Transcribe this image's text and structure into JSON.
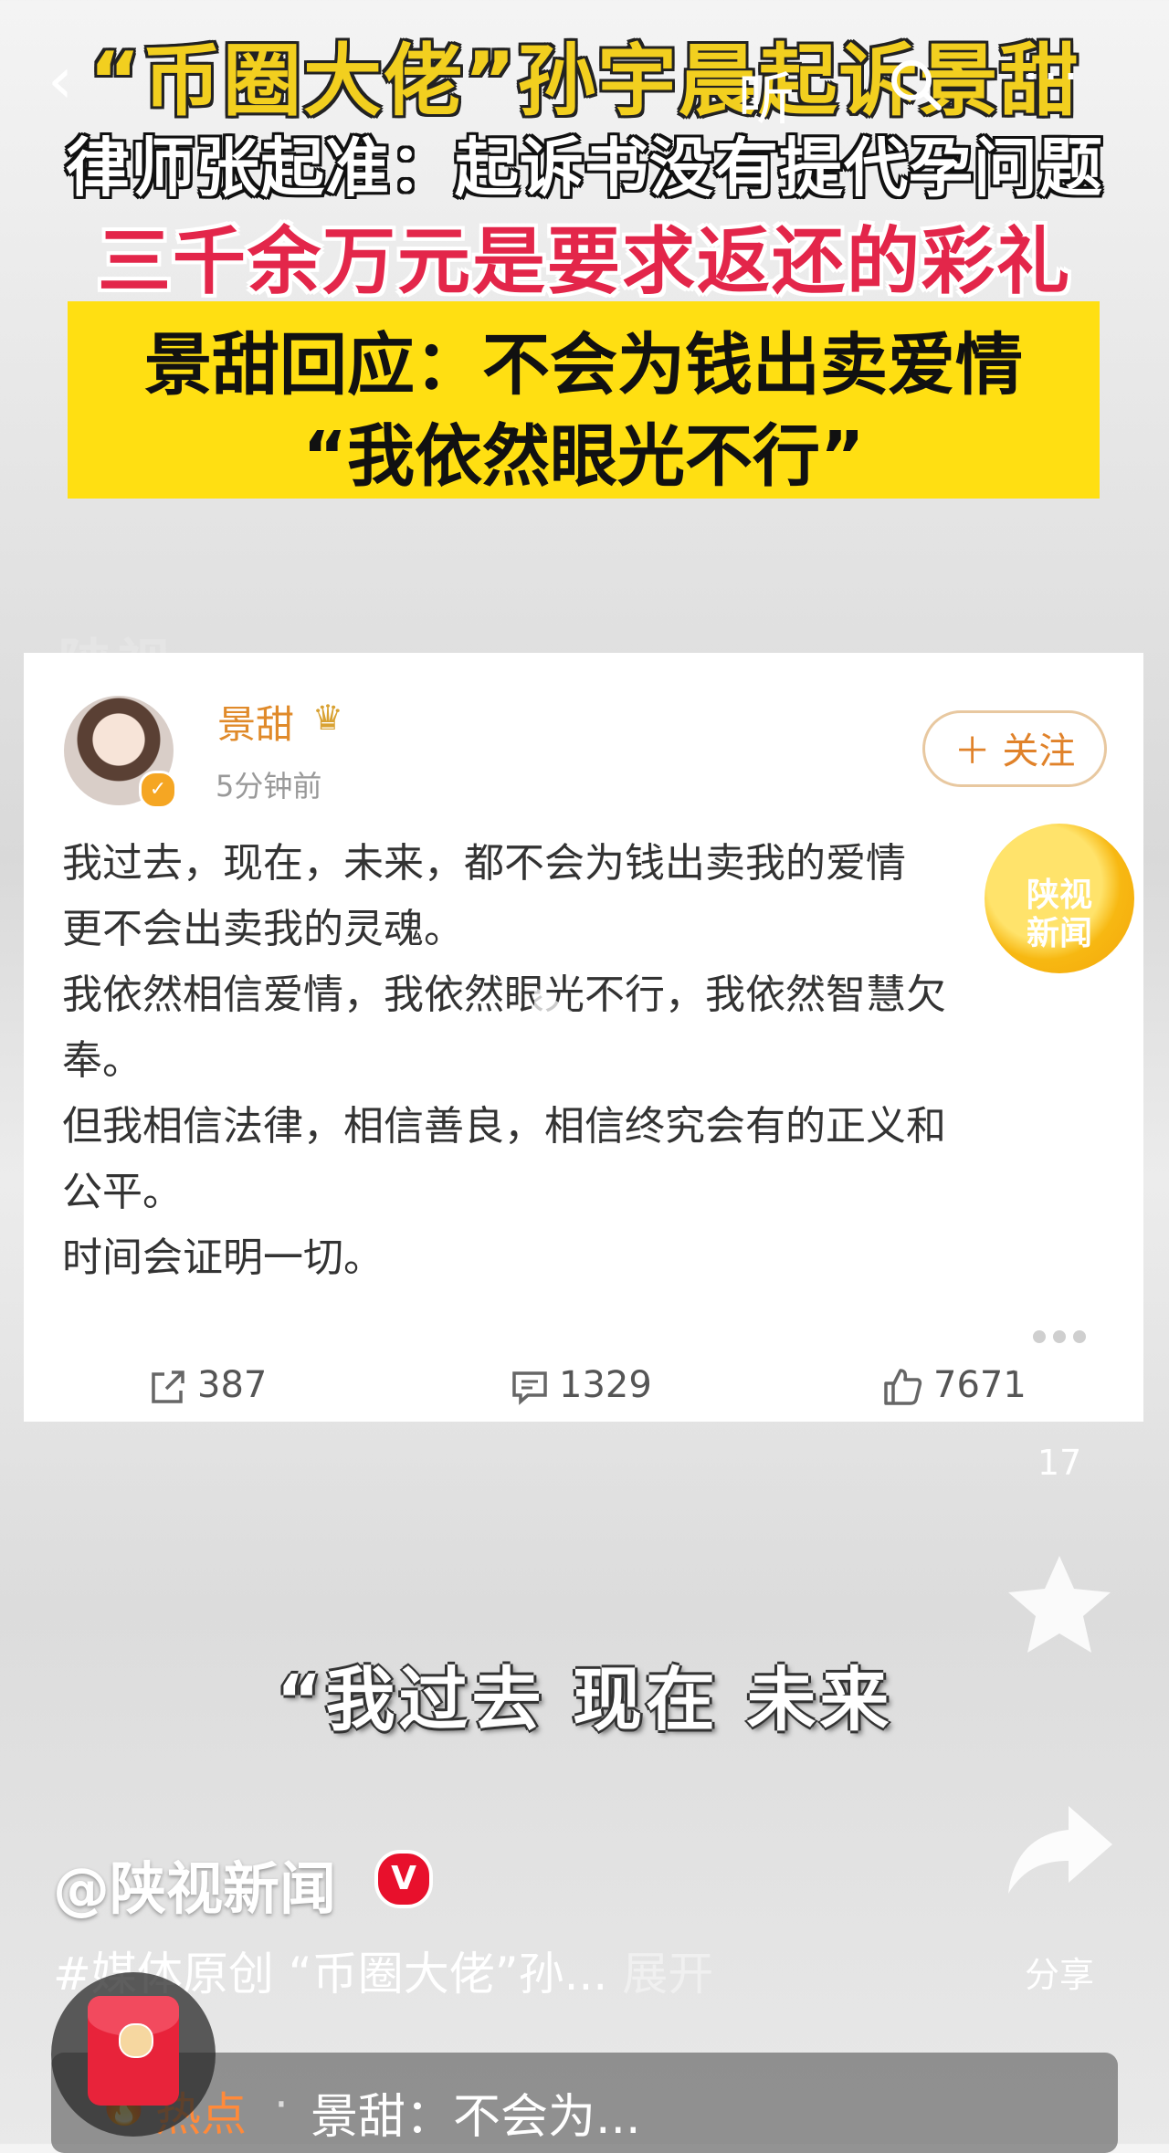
{
  "headline": {
    "line1": "“币圈大佬”孙宇晨起诉景甜",
    "line2": "律师张起准：起诉书没有提代孕问题",
    "line3": "三千余万元是要求返还的彩礼",
    "box_line1": "景甜回应：不会为钱出卖爱情",
    "box_line2": "“我依然眼光不行”"
  },
  "nav": {
    "back_icon": "‹",
    "listen_label": "听",
    "more_icon": "···"
  },
  "watermark": "陕视",
  "post": {
    "username": "景甜",
    "time": "5分钟前",
    "follow_label": "＋ 关注",
    "lines": [
      "我过去，现在，未来，都不会为钱出卖我的爱情",
      "更不会出卖我的灵魂。",
      "我依然相信爱情，我依然眼光不行，我依然智慧欠",
      "奉。",
      "但我相信法律，相信善良，相信终究会有的正义和",
      "公平。",
      "时间会证明一切。"
    ],
    "reposts": "387",
    "comments": "1329",
    "likes": "7671"
  },
  "channel_logo": {
    "line1": "陕视",
    "line2": "新闻"
  },
  "rail": {
    "comment_count": "17",
    "share_label": "分享"
  },
  "caption": "“我过去 现在 未来",
  "author": "@陕视新闻",
  "verified_mark": "V",
  "description": "#媒体原创 “币圈大佬”孙...",
  "expand_label": "展开",
  "hot": {
    "label": "热点",
    "dot": "·",
    "text": "景甜：不会为..."
  },
  "colors": {
    "accent_yellow": "#ffdf12",
    "headline_red": "#e3264a",
    "username_orange": "#e08a2a",
    "verified_red": "#e8102c"
  }
}
